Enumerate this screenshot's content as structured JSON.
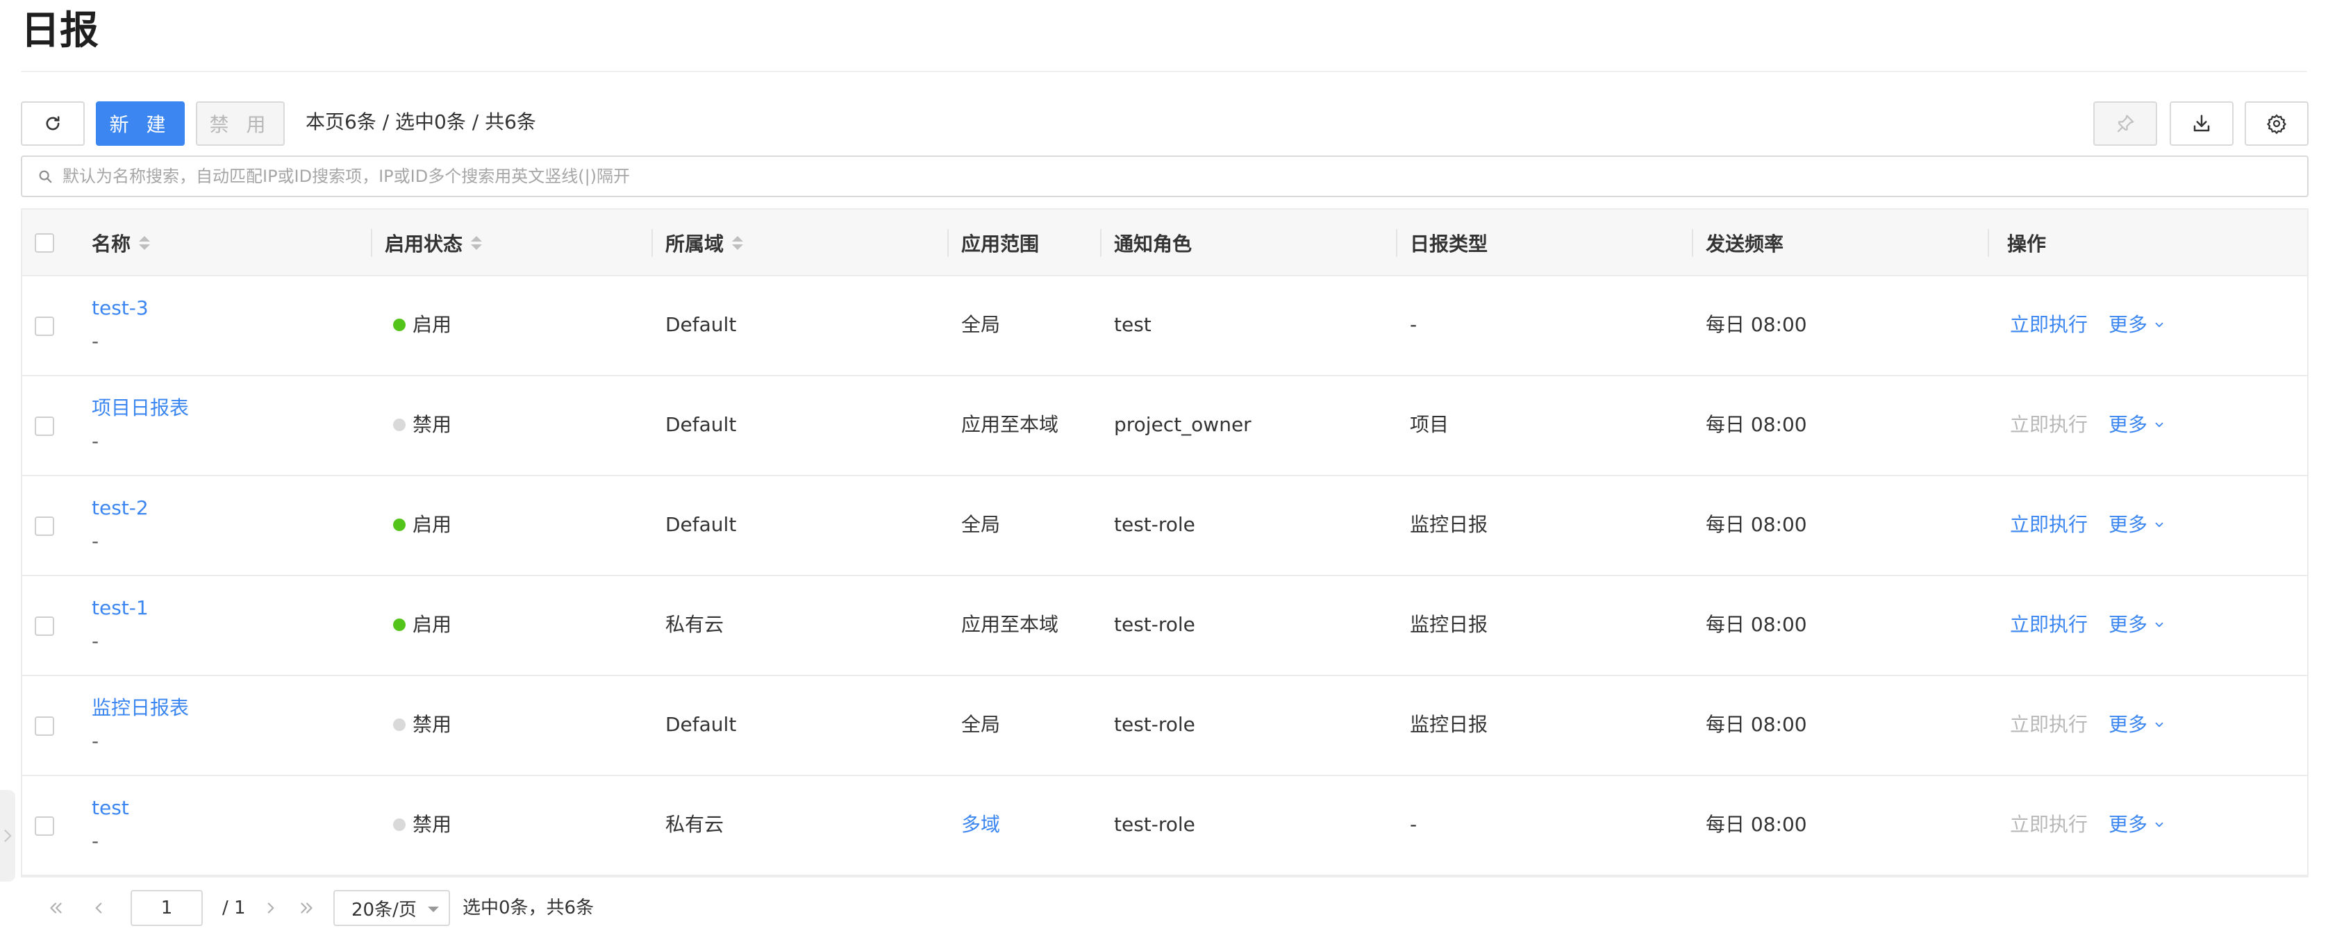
{
  "page": {
    "title": "日报"
  },
  "toolbar": {
    "new_label": "新 建",
    "disable_label": "禁 用",
    "stats": "本页6条 / 选中0条 / 共6条",
    "icons": [
      "refresh-icon",
      "pin-icon",
      "download-icon",
      "settings-icon"
    ]
  },
  "search": {
    "placeholder": "默认为名称搜索，自动匹配IP或ID搜索项，IP或ID多个搜索用英文竖线(|)隔开",
    "value": ""
  },
  "table": {
    "columns": [
      "名称",
      "启用状态",
      "所属域",
      "应用范围",
      "通知角色",
      "日报类型",
      "发送频率",
      "操作"
    ],
    "sortable_columns": [
      "名称",
      "启用状态",
      "所属域"
    ],
    "rows": [
      {
        "name": "test-3",
        "desc": "-",
        "status": "启用",
        "status_on": true,
        "domain": "Default",
        "scope": "全局",
        "scope_link": false,
        "role": "test",
        "type": "-",
        "freq": "每日 08:00",
        "run": "立即执行",
        "run_enabled": true,
        "more": "更多"
      },
      {
        "name": "项目日报表",
        "desc": "-",
        "status": "禁用",
        "status_on": false,
        "domain": "Default",
        "scope": "应用至本域",
        "scope_link": false,
        "role": "project_owner",
        "type": "项目",
        "freq": "每日 08:00",
        "run": "立即执行",
        "run_enabled": false,
        "more": "更多"
      },
      {
        "name": "test-2",
        "desc": "-",
        "status": "启用",
        "status_on": true,
        "domain": "Default",
        "scope": "全局",
        "scope_link": false,
        "role": "test-role",
        "type": "监控日报",
        "freq": "每日 08:00",
        "run": "立即执行",
        "run_enabled": true,
        "more": "更多"
      },
      {
        "name": "test-1",
        "desc": "-",
        "status": "启用",
        "status_on": true,
        "domain": "私有云",
        "scope": "应用至本域",
        "scope_link": false,
        "role": "test-role",
        "type": "监控日报",
        "freq": "每日 08:00",
        "run": "立即执行",
        "run_enabled": true,
        "more": "更多"
      },
      {
        "name": "监控日报表",
        "desc": "-",
        "status": "禁用",
        "status_on": false,
        "domain": "Default",
        "scope": "全局",
        "scope_link": false,
        "role": "test-role",
        "type": "监控日报",
        "freq": "每日 08:00",
        "run": "立即执行",
        "run_enabled": false,
        "more": "更多"
      },
      {
        "name": "test",
        "desc": "-",
        "status": "禁用",
        "status_on": false,
        "domain": "私有云",
        "scope": "多域",
        "scope_link": true,
        "role": "test-role",
        "type": "-",
        "freq": "每日 08:00",
        "run": "立即执行",
        "run_enabled": false,
        "more": "更多"
      }
    ]
  },
  "pagination": {
    "current_page": "1",
    "total_pages": "/ 1",
    "page_size": "20条/页",
    "summary": "选中0条，共6条"
  },
  "colors": {
    "accent": "#3b86f1",
    "enabled_dot": "#52c41a",
    "disabled_dot": "#d9d9d9",
    "muted_text": "#b8b8b8"
  }
}
